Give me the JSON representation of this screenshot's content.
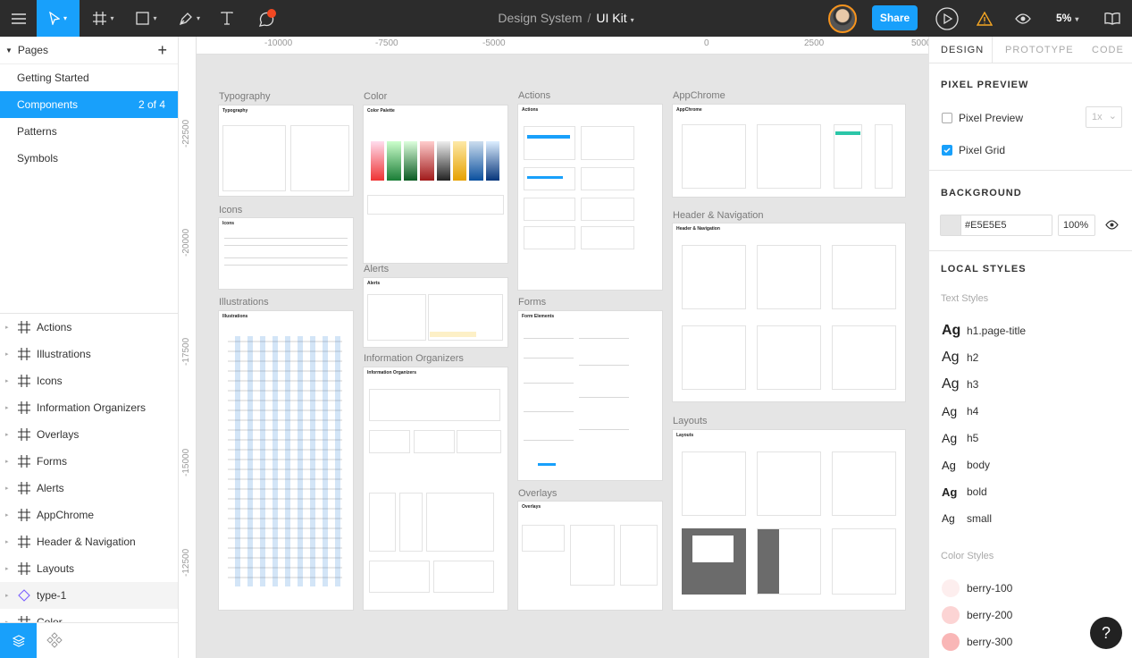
{
  "toolbar": {
    "project": "Design System",
    "separator": "/",
    "file": "UI Kit",
    "share_label": "Share",
    "zoom_label": "5%",
    "icons": [
      "menu-icon",
      "move-tool-icon",
      "frame-tool-icon",
      "shape-tool-icon",
      "pen-tool-icon",
      "text-tool-icon",
      "comment-tool-icon",
      "present-icon",
      "warning-icon",
      "view-icon",
      "library-icon"
    ],
    "accent": "#18a0fb"
  },
  "pages": {
    "header": "Pages",
    "items": [
      {
        "label": "Getting Started"
      },
      {
        "label": "Components",
        "count": "2 of 4",
        "selected": true
      },
      {
        "label": "Patterns"
      },
      {
        "label": "Symbols"
      }
    ]
  },
  "layers": [
    {
      "label": "Actions"
    },
    {
      "label": "Illustrations"
    },
    {
      "label": "Icons"
    },
    {
      "label": "Information Organizers"
    },
    {
      "label": "Overlays"
    },
    {
      "label": "Forms"
    },
    {
      "label": "Alerts"
    },
    {
      "label": "AppChrome"
    },
    {
      "label": "Header & Navigation"
    },
    {
      "label": "Layouts"
    },
    {
      "label": "type-1",
      "component": true
    },
    {
      "label": "Color"
    }
  ],
  "rulers": {
    "top": [
      "-10000",
      "-7500",
      "-5000",
      "0",
      "2500",
      "5000"
    ],
    "left": [
      "-22500",
      "-20000",
      "-17500",
      "-15000",
      "-12500"
    ]
  },
  "canvas": {
    "frames": [
      {
        "label": "Typography",
        "header": "Typography"
      },
      {
        "label": "Icons",
        "header": "Icons"
      },
      {
        "label": "Illustrations",
        "header": "Illustrations"
      },
      {
        "label": "Color",
        "header": "Color Palette"
      },
      {
        "label": "Alerts",
        "header": "Alerts"
      },
      {
        "label": "Information Organizers",
        "header": "Information Organizers"
      },
      {
        "label": "Actions",
        "header": "Actions"
      },
      {
        "label": "Forms",
        "header": "Form Elements"
      },
      {
        "label": "Overlays",
        "header": "Overlays"
      },
      {
        "label": "AppChrome",
        "header": "AppChrome"
      },
      {
        "label": "Header & Navigation",
        "header": "Header & Navigation"
      },
      {
        "label": "Layouts",
        "header": "Layouts"
      }
    ],
    "background": "#E5E5E5"
  },
  "inspector": {
    "tabs": [
      "DESIGN",
      "PROTOTYPE",
      "CODE"
    ],
    "pixel_preview_title": "PIXEL PREVIEW",
    "pixel_preview_label": "Pixel Preview",
    "pixel_preview_checked": false,
    "pixel_scale": "1x",
    "pixel_grid_label": "Pixel Grid",
    "pixel_grid_checked": true,
    "background_title": "BACKGROUND",
    "background_hex": "#E5E5E5",
    "background_opacity": "100%",
    "local_styles_title": "LOCAL STYLES",
    "text_styles_title": "Text Styles",
    "text_styles": [
      {
        "sample": "Ag",
        "name": "h1.page-title"
      },
      {
        "sample": "Ag",
        "name": "h2"
      },
      {
        "sample": "Ag",
        "name": "h3"
      },
      {
        "sample": "Ag",
        "name": "h4"
      },
      {
        "sample": "Ag",
        "name": "h5"
      },
      {
        "sample": "Ag",
        "name": "body"
      },
      {
        "sample": "Ag",
        "name": "bold"
      },
      {
        "sample": "Ag",
        "name": "small"
      }
    ],
    "color_styles_title": "Color Styles",
    "color_styles": [
      {
        "name": "berry-100",
        "color": "#fdeeee"
      },
      {
        "name": "berry-200",
        "color": "#fcd4d4"
      },
      {
        "name": "berry-300",
        "color": "#f9b6b6"
      }
    ],
    "help_label": "?"
  }
}
